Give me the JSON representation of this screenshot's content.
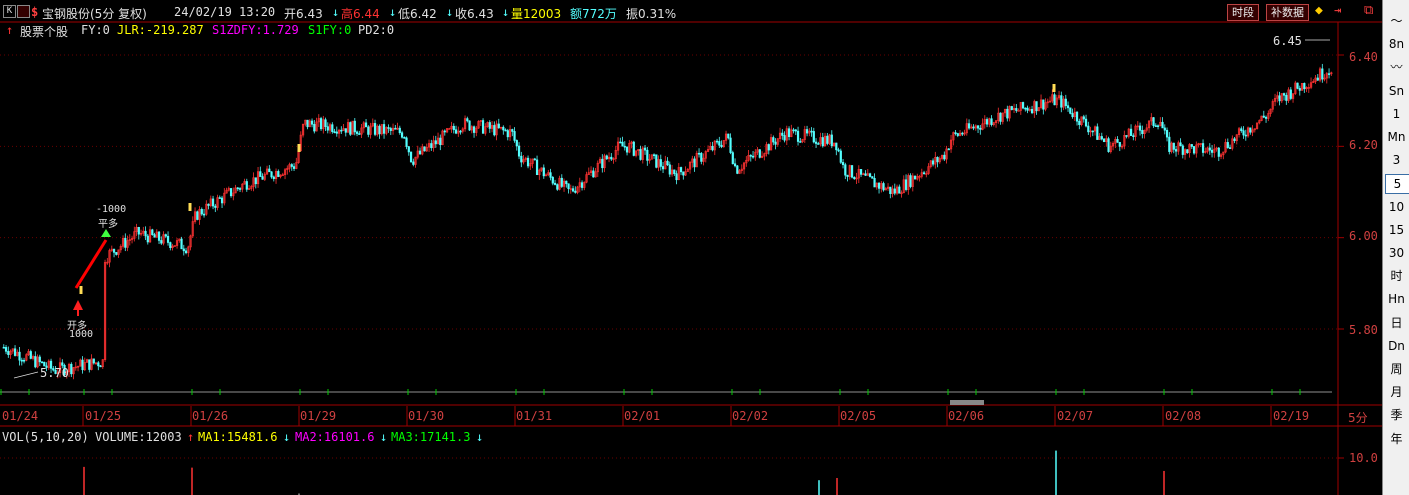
{
  "title": {
    "k_label": "K",
    "stock_name": "宝钢股份(5分 复权)",
    "datetime": "24/02/19 13:20",
    "open": "开6.43",
    "open_arrow": "↓",
    "high": "高6.44",
    "high_arrow": "↓",
    "low": "低6.42",
    "low_arrow": "↓",
    "close": "收6.43",
    "close_arrow": "↓",
    "volume": "量12003",
    "amount": "额772万",
    "amplitude": "振0.31%",
    "btn_period": "时段",
    "btn_fill": "补数据"
  },
  "indicator_line": {
    "arrow": "↑",
    "name": "股票个股",
    "fy": "FY:0",
    "jlr": "JLR:-219.287",
    "s1zdfy": "S1ZDFY:1.729",
    "s1fy": "S1FY:0",
    "pd2": "PD2:0"
  },
  "price_axis": [
    "6.40",
    "6.20",
    "6.00",
    "5.80"
  ],
  "period_unit": "5分",
  "dates": [
    "01/24",
    "01/25",
    "01/26",
    "01/29",
    "01/30",
    "01/31",
    "02/01",
    "02/02",
    "02/05",
    "02/06",
    "02/07",
    "02/08",
    "02/19"
  ],
  "annotations": {
    "low_label": "5.70",
    "high_label": "6.45",
    "signal_top_value": "-1000",
    "signal_top_text": "平多",
    "signal_bottom_text": "开多",
    "signal_bottom_value": "1000"
  },
  "volume_line": {
    "label": "VOL(5,10,20)",
    "volume": "VOLUME:12003",
    "volume_arrow": "↑",
    "ma1": "MA1:15481.6",
    "ma1_arrow": "↓",
    "ma2": "MA2:16101.6",
    "ma2_arrow": "↓",
    "ma3": "MA3:17141.3",
    "ma3_arrow": "↓"
  },
  "volume_axis": [
    "10.0"
  ],
  "sidebar": [
    "〜",
    "8n",
    "〰",
    "Sn",
    "1",
    "Mn",
    "3",
    "5",
    "10",
    "15",
    "30",
    "时",
    "Hn",
    "日",
    "Dn",
    "周",
    "月",
    "季",
    "年"
  ],
  "sidebar_active": "5",
  "colors": {
    "up": "#ff3232",
    "down": "#54ffff",
    "frame": "#a00000",
    "ma1": "#ffff00",
    "ma2": "#ff00ff",
    "ma3": "#00ff00"
  },
  "chart_data": {
    "type": "candlestick",
    "y_range": [
      5.66,
      6.45
    ],
    "price_path": [
      [
        "01/24",
        5.76
      ],
      [
        "01/24",
        5.71
      ],
      [
        "01/24",
        5.73
      ],
      [
        "01/25",
        5.93
      ],
      [
        "01/25",
        6.01
      ],
      [
        "01/25",
        5.98
      ],
      [
        "01/26",
        6.05
      ],
      [
        "01/26",
        6.12
      ],
      [
        "01/26",
        6.16
      ],
      [
        "01/29",
        6.25
      ],
      [
        "01/29",
        6.23
      ],
      [
        "01/30",
        6.17
      ],
      [
        "01/30",
        6.25
      ],
      [
        "01/30",
        6.23
      ],
      [
        "01/31",
        6.18
      ],
      [
        "01/31",
        6.1
      ],
      [
        "01/31",
        6.2
      ],
      [
        "02/01",
        6.2
      ],
      [
        "02/01",
        6.14
      ],
      [
        "02/01",
        6.22
      ],
      [
        "02/02",
        6.15
      ],
      [
        "02/02",
        6.23
      ],
      [
        "02/02",
        6.21
      ],
      [
        "02/05",
        6.15
      ],
      [
        "02/05",
        6.1
      ],
      [
        "02/05",
        6.18
      ],
      [
        "02/06",
        6.22
      ],
      [
        "02/06",
        6.27
      ],
      [
        "02/06",
        6.3
      ],
      [
        "02/07",
        6.3
      ],
      [
        "02/07",
        6.2
      ],
      [
        "02/07",
        6.26
      ],
      [
        "02/08",
        6.2
      ],
      [
        "02/08",
        6.19
      ],
      [
        "02/08",
        6.27
      ],
      [
        "02/19",
        6.3
      ],
      [
        "02/19",
        6.43
      ]
    ],
    "volume_spikes": [
      {
        "date": "01/25",
        "value": 7.6
      },
      {
        "date": "01/26",
        "value": 7.4
      },
      {
        "date": "02/05",
        "value": 4.0
      },
      {
        "date": "02/07",
        "value": 12.0
      },
      {
        "date": "02/08",
        "value": 6.5
      }
    ]
  }
}
